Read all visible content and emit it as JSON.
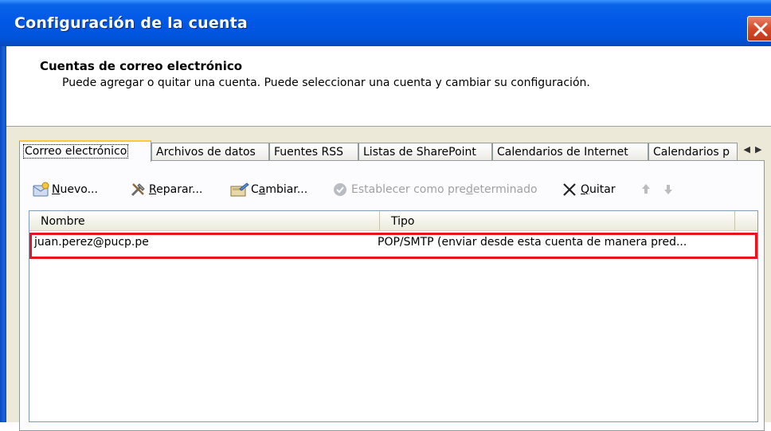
{
  "window": {
    "title": "Configuración de la cuenta"
  },
  "header": {
    "title": "Cuentas de correo electrónico",
    "description": "Puede agregar o quitar una cuenta. Puede seleccionar una cuenta y cambiar su configuración."
  },
  "tabs": [
    {
      "label": "Correo electrónico",
      "active": true
    },
    {
      "label": "Archivos de datos",
      "active": false
    },
    {
      "label": "Fuentes RSS",
      "active": false
    },
    {
      "label": "Listas de SharePoint",
      "active": false
    },
    {
      "label": "Calendarios de Internet",
      "active": false
    },
    {
      "label": "Calendarios p",
      "active": false
    }
  ],
  "toolbar": {
    "new_prefix": "",
    "new_underline": "N",
    "new_suffix": "uevo...",
    "repair_prefix": "",
    "repair_underline": "R",
    "repair_suffix": "eparar...",
    "change_prefix": "C",
    "change_underline": "a",
    "change_suffix": "mbiar...",
    "default_prefix": "Establecer como pre",
    "default_underline": "d",
    "default_suffix": "eterminado",
    "remove_prefix": "",
    "remove_underline": "Q",
    "remove_suffix": "uitar"
  },
  "list": {
    "columns": [
      "Nombre",
      "Tipo"
    ],
    "rows": [
      {
        "name": "juan.perez@pucp.pe",
        "type": "POP/SMTP (enviar desde esta cuenta de manera pred..."
      }
    ]
  },
  "colors": {
    "titlebar": "#0054dc",
    "highlight_border": "#e8141c",
    "active_tab_accent": "#ffc83c",
    "close_button": "#d6492a"
  },
  "icons": {
    "new": "new-account-icon",
    "repair": "repair-tools-icon",
    "change": "change-account-icon",
    "default": "checkmark-circle-icon",
    "remove": "x-remove-icon",
    "up": "arrow-up-icon",
    "down": "arrow-down-icon",
    "close": "close-icon"
  }
}
